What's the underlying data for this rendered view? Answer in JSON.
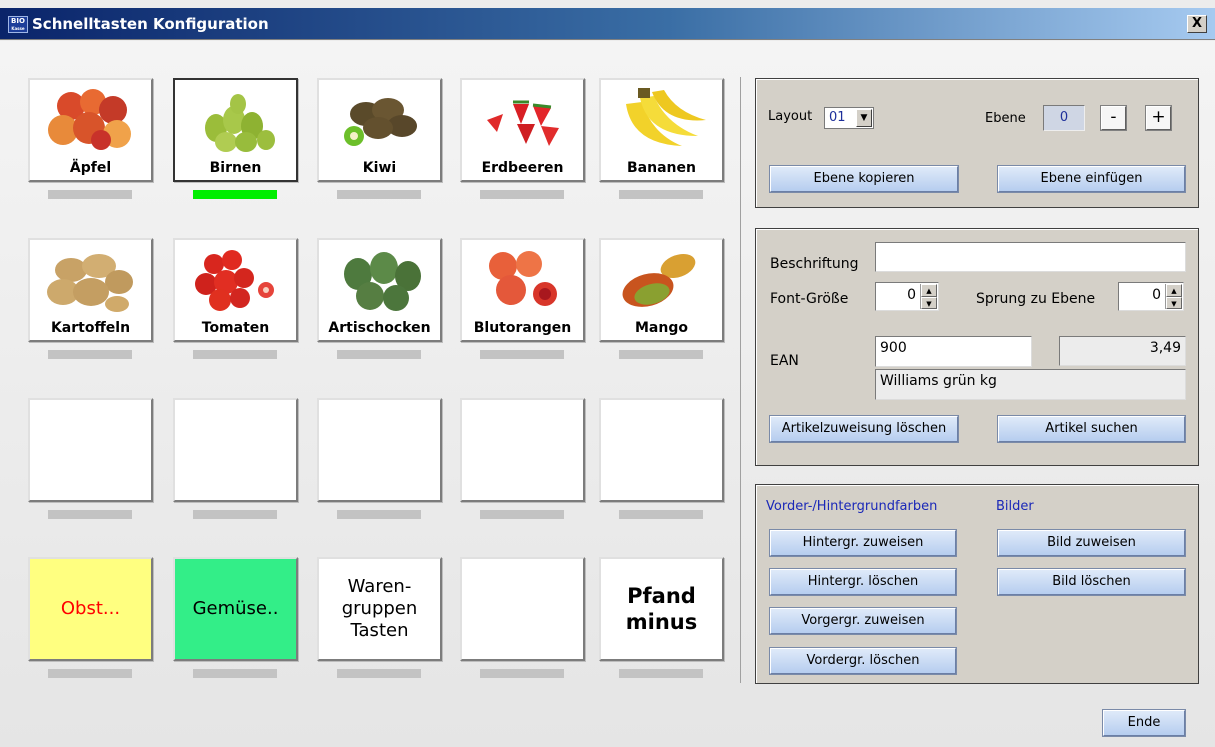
{
  "window": {
    "title": "Schnelltasten Konfiguration",
    "icon_text_1": "BIO",
    "icon_text_2": "Kasse",
    "close_label": "X"
  },
  "tiles": [
    {
      "label": "Äpfel",
      "icon": "apples-icon"
    },
    {
      "label": "Birnen",
      "icon": "pears-icon",
      "selected": true
    },
    {
      "label": "Kiwi",
      "icon": "kiwi-icon"
    },
    {
      "label": "Erdbeeren",
      "icon": "strawberries-icon"
    },
    {
      "label": "Bananen",
      "icon": "bananas-icon"
    },
    {
      "label": "Kartoffeln",
      "icon": "potatoes-icon"
    },
    {
      "label": "Tomaten",
      "icon": "tomatoes-icon"
    },
    {
      "label": "Artischocken",
      "icon": "artichokes-icon"
    },
    {
      "label": "Blutorangen",
      "icon": "blood-oranges-icon"
    },
    {
      "label": "Mango",
      "icon": "mango-icon"
    },
    {
      "label": ""
    },
    {
      "label": ""
    },
    {
      "label": ""
    },
    {
      "label": ""
    },
    {
      "label": ""
    },
    {
      "label": "Obst...",
      "bg": "#ffff80",
      "color": "#ff0000"
    },
    {
      "label": "Gemüse..",
      "bg": "#33ee88",
      "color": "#000000"
    },
    {
      "label_lines": [
        "Waren-",
        "gruppen",
        "Tasten"
      ],
      "bg": "#ffffff"
    },
    {
      "label": ""
    },
    {
      "label_lines": [
        "Pfand",
        "minus"
      ],
      "bold": true
    }
  ],
  "layout_panel": {
    "layout_label": "Layout",
    "layout_value": "01",
    "level_label": "Ebene",
    "level_value": "0",
    "minus_label": "-",
    "plus_label": "+",
    "copy_level_label": "Ebene kopieren",
    "paste_level_label": "Ebene einfügen"
  },
  "key_panel": {
    "caption_label": "Beschriftung",
    "caption_value": "",
    "font_size_label": "Font-Größe",
    "font_size_value": "0",
    "jump_label": "Sprung zu Ebene",
    "jump_value": "0",
    "ean_label": "EAN",
    "ean_value": "900",
    "price_value": "3,49",
    "article_name": "Williams grün kg",
    "delete_assignment_label": "Artikelzuweisung löschen",
    "search_article_label": "Artikel suchen"
  },
  "color_panel": {
    "colors_heading": "Vorder-/Hintergrundfarben",
    "images_heading": "Bilder",
    "bg_assign_label": "Hintergr. zuweisen",
    "bg_delete_label": "Hintergr. löschen",
    "fg_assign_label": "Vorgergr. zuweisen",
    "fg_delete_label": "Vordergr. löschen",
    "img_assign_label": "Bild zuweisen",
    "img_delete_label": "Bild löschen"
  },
  "footer": {
    "end_label": "Ende"
  }
}
